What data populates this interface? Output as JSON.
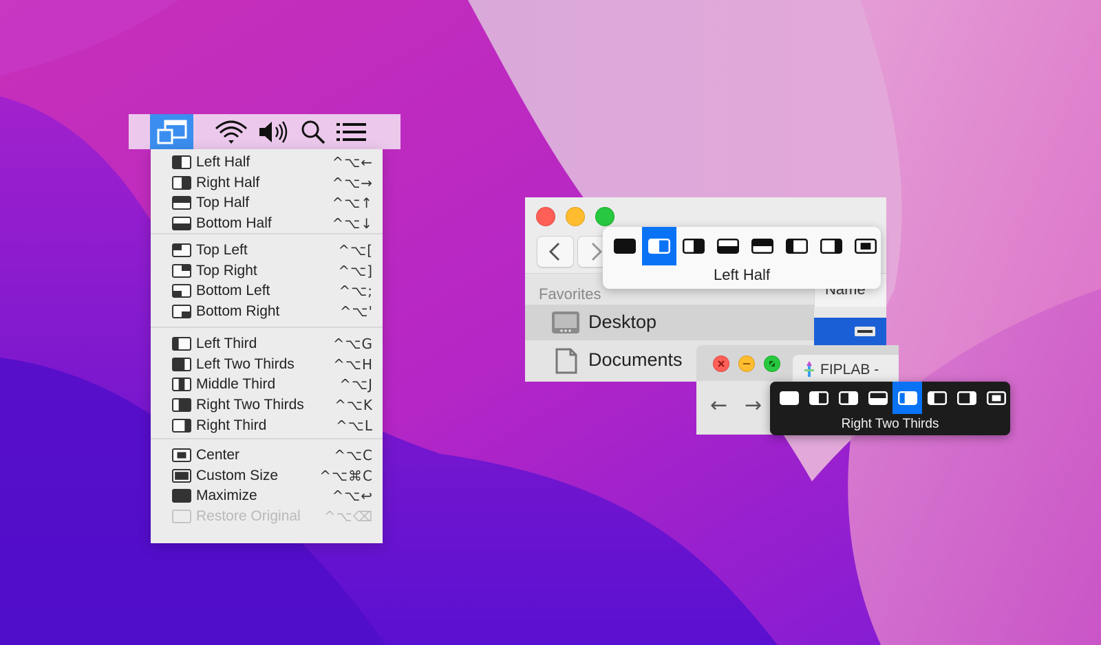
{
  "menubar": {
    "icons": [
      "window-layout-icon",
      "wifi-icon",
      "volume-icon",
      "search-icon",
      "list-icon"
    ]
  },
  "menu": {
    "groups": [
      [
        {
          "label": "Left Half",
          "shortcut": "^⌥←",
          "icon": "left-half"
        },
        {
          "label": "Right Half",
          "shortcut": "^⌥→",
          "icon": "right-half"
        },
        {
          "label": "Top Half",
          "shortcut": "^⌥↑",
          "icon": "top-half"
        },
        {
          "label": "Bottom Half",
          "shortcut": "^⌥↓",
          "icon": "bottom-half"
        }
      ],
      [
        {
          "label": "Top Left",
          "shortcut": "^⌥[",
          "icon": "top-left"
        },
        {
          "label": "Top Right",
          "shortcut": "^⌥]",
          "icon": "top-right"
        },
        {
          "label": "Bottom Left",
          "shortcut": "^⌥;",
          "icon": "bottom-left"
        },
        {
          "label": "Bottom Right",
          "shortcut": "^⌥'",
          "icon": "bottom-right"
        }
      ],
      [
        {
          "label": "Left Third",
          "shortcut": "^⌥G",
          "icon": "left-third"
        },
        {
          "label": "Left Two Thirds",
          "shortcut": "^⌥H",
          "icon": "left-two-thirds"
        },
        {
          "label": "Middle Third",
          "shortcut": "^⌥J",
          "icon": "middle-third"
        },
        {
          "label": "Right Two Thirds",
          "shortcut": "^⌥K",
          "icon": "right-two-thirds"
        },
        {
          "label": "Right Third",
          "shortcut": "^⌥L",
          "icon": "right-third"
        }
      ],
      [
        {
          "label": "Center",
          "shortcut": "^⌥C",
          "icon": "center"
        },
        {
          "label": "Custom Size",
          "shortcut": "^⌥⌘C",
          "icon": "custom-size"
        },
        {
          "label": "Maximize",
          "shortcut": "^⌥↩",
          "icon": "maximize"
        },
        {
          "label": "Restore Original",
          "shortcut": "^⌥⌫",
          "icon": "restore",
          "disabled": true
        }
      ]
    ]
  },
  "finder": {
    "sidebar_heading": "Favorites",
    "items": [
      "Desktop",
      "Documents"
    ],
    "column_header": "Name"
  },
  "popup_light": {
    "caption": "Left Half",
    "selected_index": 1,
    "icons": [
      "maximize",
      "left-half",
      "right-half",
      "bottom-half",
      "top-half",
      "left-third",
      "right-third",
      "center"
    ]
  },
  "browser": {
    "tab_title": "FIPLAB -"
  },
  "popup_dark": {
    "caption": "Right Two Thirds",
    "selected_index": 4,
    "icons": [
      "maximize",
      "left-half",
      "right-half",
      "bottom-half",
      "right-two-thirds",
      "left-third",
      "right-third",
      "center"
    ]
  },
  "colors": {
    "accent": "#0a73f5",
    "menubar_highlight": "#3b8ef0",
    "traffic_red": "#fe5f57",
    "traffic_yellow": "#febc2e",
    "traffic_green": "#28c840"
  }
}
